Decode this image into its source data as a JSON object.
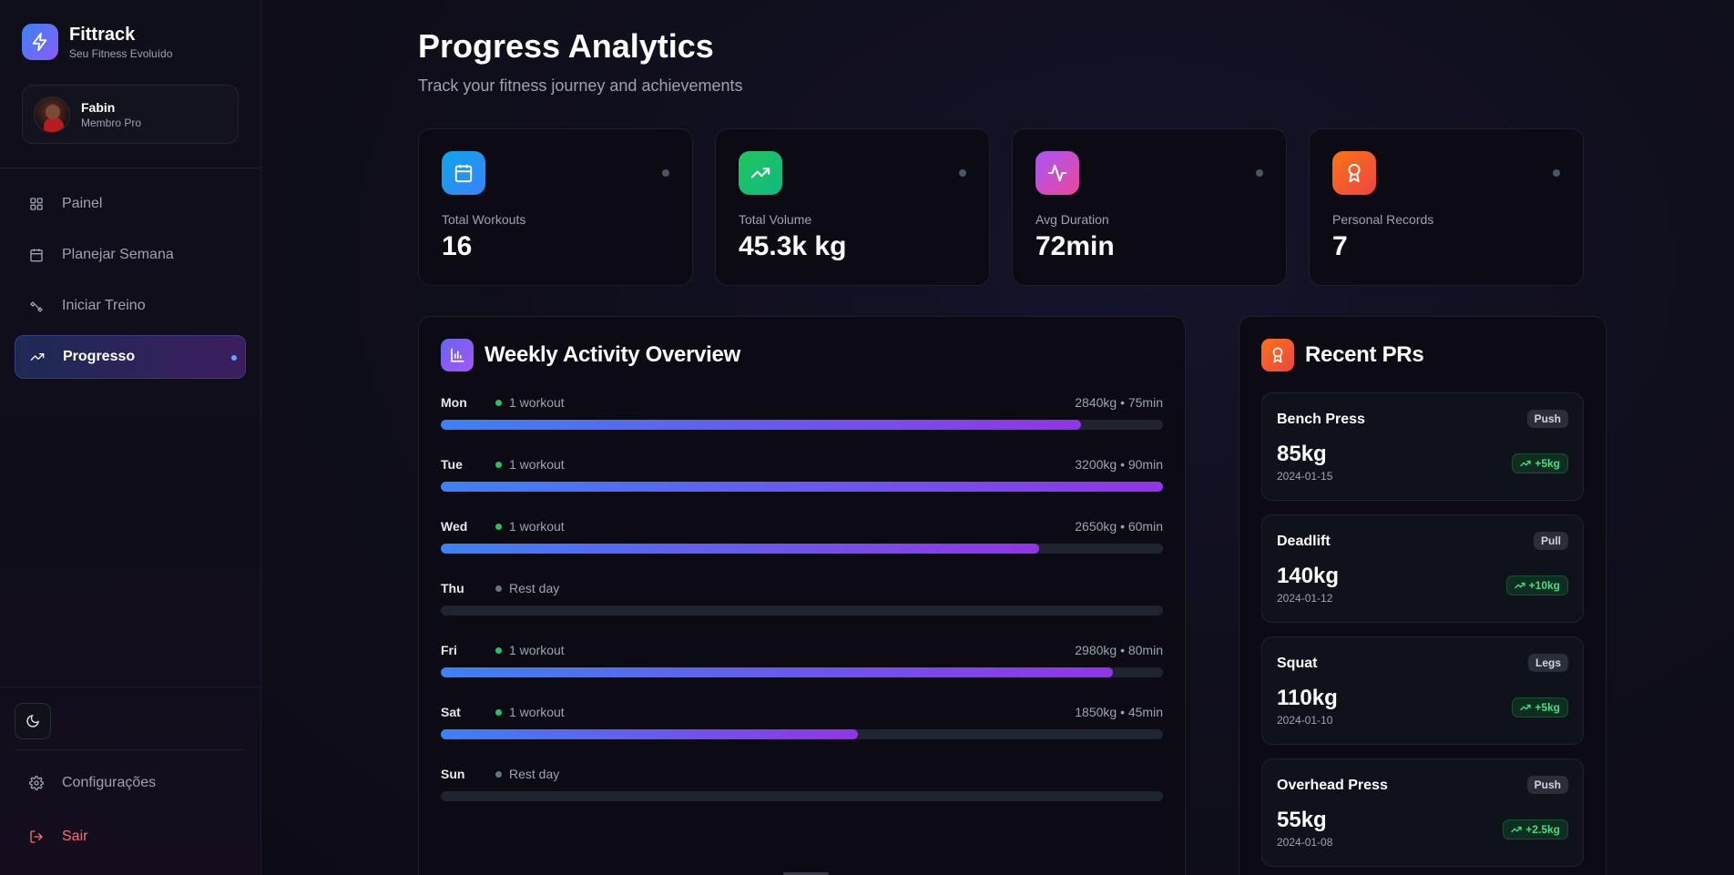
{
  "brand": {
    "name": "Fittrack",
    "tagline": "Seu Fitness Evoluído"
  },
  "user": {
    "name": "Fabin",
    "role": "Membro Pro"
  },
  "nav": {
    "items": [
      {
        "label": "Painel",
        "icon": "grid-icon"
      },
      {
        "label": "Planejar Semana",
        "icon": "calendar-icon"
      },
      {
        "label": "Iniciar Treino",
        "icon": "dumbbell-icon"
      },
      {
        "label": "Progresso",
        "icon": "trending-up-icon",
        "active": true
      }
    ],
    "settings_label": "Configurações",
    "logout_label": "Sair"
  },
  "page": {
    "title": "Progress Analytics",
    "subtitle": "Track your fitness journey and achievements"
  },
  "stats": [
    {
      "label": "Total Workouts",
      "value": "16",
      "icon": "calendar-icon",
      "color": "#0ea5e9"
    },
    {
      "label": "Total Volume",
      "value": "45.3k kg",
      "icon": "trending-up-icon",
      "color": "#22c55e"
    },
    {
      "label": "Avg Duration",
      "value": "72min",
      "icon": "activity-icon",
      "color": "#a855f7"
    },
    {
      "label": "Personal Records",
      "value": "7",
      "icon": "award-icon",
      "color": "#f97316"
    }
  ],
  "weekly": {
    "title": "Weekly Activity Overview",
    "days": [
      {
        "day": "Mon",
        "status": "1 workout",
        "stats": "2840kg • 75min",
        "fill": 0.887,
        "rest": false
      },
      {
        "day": "Tue",
        "status": "1 workout",
        "stats": "3200kg • 90min",
        "fill": 1.0,
        "rest": false
      },
      {
        "day": "Wed",
        "status": "1 workout",
        "stats": "2650kg • 60min",
        "fill": 0.828,
        "rest": false
      },
      {
        "day": "Thu",
        "status": "Rest day",
        "stats": "",
        "fill": 0,
        "rest": true
      },
      {
        "day": "Fri",
        "status": "1 workout",
        "stats": "2980kg • 80min",
        "fill": 0.931,
        "rest": false
      },
      {
        "day": "Sat",
        "status": "1 workout",
        "stats": "1850kg • 45min",
        "fill": 0.578,
        "rest": false
      },
      {
        "day": "Sun",
        "status": "Rest day",
        "stats": "",
        "fill": 0,
        "rest": true
      }
    ]
  },
  "prs": {
    "title": "Recent PRs",
    "items": [
      {
        "name": "Bench Press",
        "tag": "Push",
        "value": "85kg",
        "date": "2024-01-15",
        "gain": "+5kg"
      },
      {
        "name": "Deadlift",
        "tag": "Pull",
        "value": "140kg",
        "date": "2024-01-12",
        "gain": "+10kg"
      },
      {
        "name": "Squat",
        "tag": "Legs",
        "value": "110kg",
        "date": "2024-01-10",
        "gain": "+5kg"
      },
      {
        "name": "Overhead Press",
        "tag": "Push",
        "value": "55kg",
        "date": "2024-01-08",
        "gain": "+2.5kg"
      }
    ]
  },
  "colors": {
    "accent_blue": "#3b82f6",
    "accent_purple": "#9333ea",
    "success": "#22c55e",
    "danger": "#f87171"
  }
}
